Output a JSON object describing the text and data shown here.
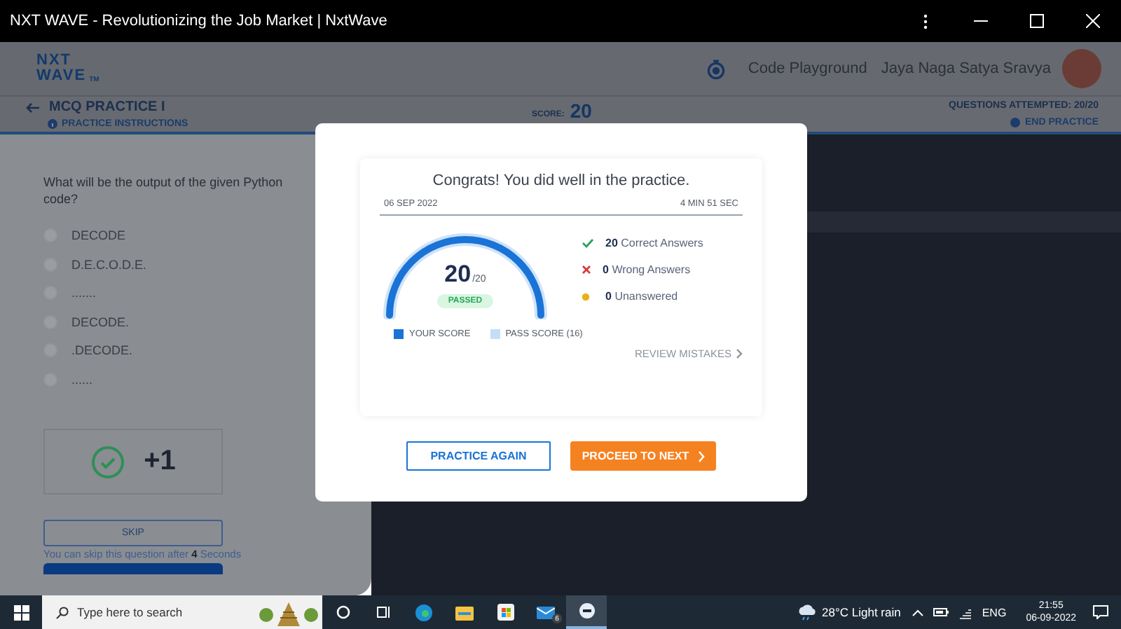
{
  "window": {
    "title": "NXT WAVE - Revolutionizing the Job Market | NxtWave"
  },
  "header": {
    "logo": [
      "NXT",
      "WAVE"
    ],
    "logo_mark": "TM",
    "nav_link": "Code Playground",
    "user_name": "Jaya Naga Satya Sravya"
  },
  "practice_bar": {
    "title": "MCQ PRACTICE I",
    "instructions_link": "PRACTICE INSTRUCTIONS",
    "score_label": "SCORE:",
    "score": "20",
    "attempted": "QUESTIONS ATTEMPTED: 20/20",
    "end_link": "END PRACTICE"
  },
  "question": {
    "text": "What will be the output of the given Python code?",
    "options": [
      {
        "label": "DECODE",
        "selected": false
      },
      {
        "label": "D.E.C.O.D.E.",
        "selected": false
      },
      {
        "label": ".......",
        "selected": false
      },
      {
        "label": "DECODE.",
        "selected": false
      },
      {
        "label": ".DECODE.",
        "selected": false
      },
      {
        "label": "......",
        "selected": false
      }
    ],
    "points": "+1",
    "skip_button": "SKIP",
    "skip_hint": "You can skip this question after **4** Seconds"
  },
  "result_dialog": {
    "message": "Congrats! You did well in the practice.",
    "date": "06 SEP 2022",
    "duration": "4 MIN 51 SEC",
    "gauge": {
      "level": 1,
      "score": "20",
      "total": "/20",
      "status": "PASSED"
    },
    "stats": [
      {
        "kind": "correct",
        "count": "20",
        "label": "Correct Answers"
      },
      {
        "kind": "wrong",
        "count": "0",
        "label": "Wrong Answers"
      },
      {
        "kind": "unanswered",
        "count": "0",
        "label": "Unanswered"
      }
    ],
    "legend": [
      {
        "label": "YOUR SCORE",
        "color": "#1a73d6"
      },
      {
        "label": "PASS SCORE (16)",
        "color": "#c5def7"
      }
    ],
    "review_link": "REVIEW MISTAKES",
    "secondary_button": "PRACTICE AGAIN",
    "primary_button": "PROCEED TO NEXT"
  },
  "taskbar": {
    "search_placeholder": "Type here to search",
    "mail_badge": "6",
    "weather": "28°C Light rain",
    "language": "ENG",
    "time": "21:55",
    "date": "06-09-2022"
  }
}
